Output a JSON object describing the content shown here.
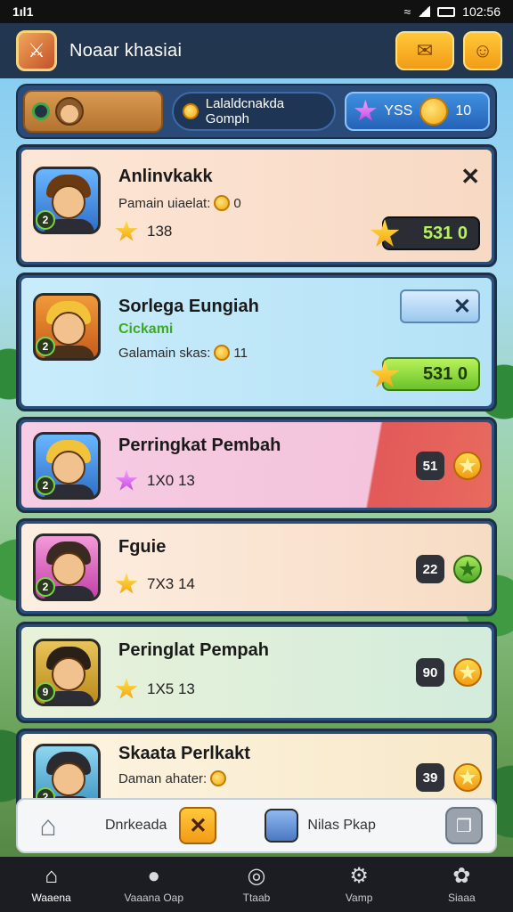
{
  "status_bar": {
    "carrier": "1ıl1",
    "time": "102:56"
  },
  "header": {
    "title": "Noaar khasiai",
    "logo_icon": "app-logo-icon",
    "mail_icon": "mail-icon",
    "profile_icon": "profile-icon"
  },
  "stats": {
    "mode_label": "Lalaldcnakda Gomph",
    "gems_value": "YSS",
    "coins_value": "10"
  },
  "cards": [
    {
      "name": "Anlinvkakk",
      "sub": "Pamain uiaelat:",
      "sub_value": "0",
      "count": "138",
      "score": "531 0"
    },
    {
      "name": "Sorlega Eungiah",
      "tag": "Cickami",
      "sub": "Galamain skas:",
      "sub_value": "11",
      "score": "531 0"
    },
    {
      "name": "Perringkat Pembah",
      "count": "1X0 13",
      "rank": "51"
    },
    {
      "name": "Fguie",
      "count": "7X3 14",
      "rank": "22"
    },
    {
      "name": "Peringlat Pempah",
      "count": "1X5 13",
      "rank": "90"
    },
    {
      "name": "Skaata Perlkakt",
      "sub": "Daman ahater:",
      "rank": "39"
    }
  ],
  "action_bar": {
    "left_label": "Dnrkeada",
    "right_label": "Nilas Pkap"
  },
  "nav": [
    {
      "label": "Waaena",
      "icon": "home-icon"
    },
    {
      "label": "Vaaana Oap",
      "icon": "user-icon"
    },
    {
      "label": "Ttaab",
      "icon": "compass-icon"
    },
    {
      "label": "Vamp",
      "icon": "gear-icon"
    },
    {
      "label": "Siaaa",
      "icon": "settings-icon"
    }
  ],
  "colors": {
    "header_bg": "#233650",
    "accent": "#f29b16",
    "nav_bg": "#1b1d22",
    "score_green": "#b8f25a"
  }
}
